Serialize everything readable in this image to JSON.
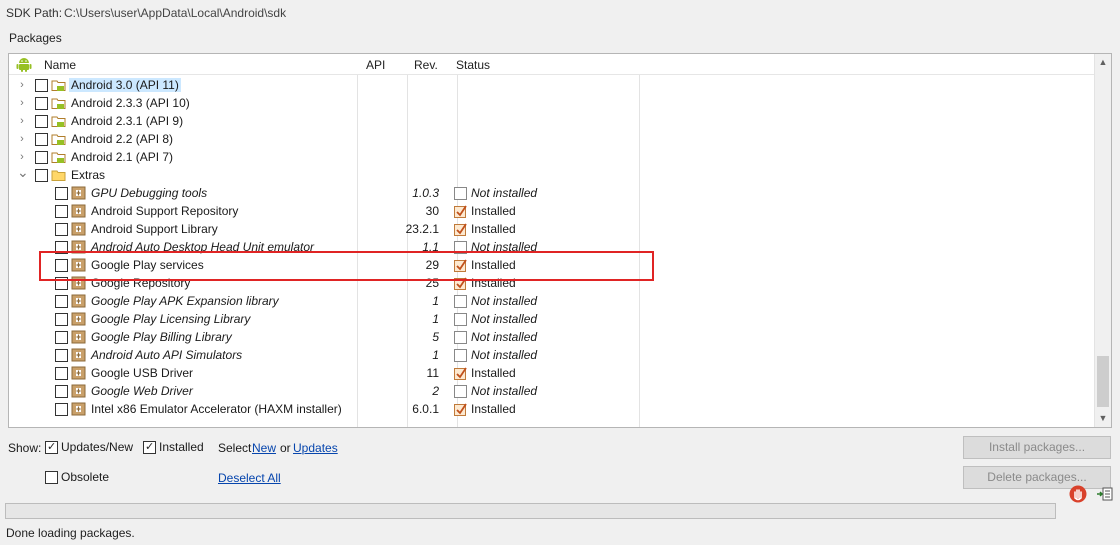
{
  "sdk": {
    "path_label": "SDK Path:",
    "path_value": "C:\\Users\\user\\AppData\\Local\\Android\\sdk"
  },
  "packages_label": "Packages",
  "table": {
    "headers": {
      "name": "Name",
      "api": "API",
      "rev": "Rev.",
      "status": "Status"
    },
    "rows": [
      {
        "name": "Android 3.0 (API 11)",
        "rev": "",
        "status": "",
        "installed": null,
        "italic": false,
        "level": 0,
        "expander": "collapsed",
        "icon": "android-folder-icon",
        "selected": true
      },
      {
        "name": "Android 2.3.3 (API 10)",
        "rev": "",
        "status": "",
        "installed": null,
        "italic": false,
        "level": 0,
        "expander": "collapsed",
        "icon": "android-folder-icon",
        "selected": false
      },
      {
        "name": "Android 2.3.1 (API 9)",
        "rev": "",
        "status": "",
        "installed": null,
        "italic": false,
        "level": 0,
        "expander": "collapsed",
        "icon": "android-folder-icon",
        "selected": false
      },
      {
        "name": "Android 2.2 (API 8)",
        "rev": "",
        "status": "",
        "installed": null,
        "italic": false,
        "level": 0,
        "expander": "collapsed",
        "icon": "android-folder-icon",
        "selected": false
      },
      {
        "name": "Android 2.1 (API 7)",
        "rev": "",
        "status": "",
        "installed": null,
        "italic": false,
        "level": 0,
        "expander": "collapsed",
        "icon": "android-folder-icon",
        "selected": false
      },
      {
        "name": "Extras",
        "rev": "",
        "status": "",
        "installed": null,
        "italic": false,
        "level": 0,
        "expander": "expanded",
        "icon": "folder-icon",
        "selected": false
      },
      {
        "name": "GPU Debugging tools",
        "rev": "1.0.3",
        "status": "Not installed",
        "installed": false,
        "italic": true,
        "level": 1,
        "expander": "none",
        "icon": "package-icon",
        "selected": false
      },
      {
        "name": "Android Support Repository",
        "rev": "30",
        "status": "Installed",
        "installed": true,
        "italic": false,
        "level": 1,
        "expander": "none",
        "icon": "package-icon",
        "selected": false
      },
      {
        "name": "Android Support Library",
        "rev": "23.2.1",
        "status": "Installed",
        "installed": true,
        "italic": false,
        "level": 1,
        "expander": "none",
        "icon": "package-icon",
        "selected": false
      },
      {
        "name": "Android Auto Desktop Head Unit emulator",
        "rev": "1.1",
        "status": "Not installed",
        "installed": false,
        "italic": true,
        "level": 1,
        "expander": "none",
        "icon": "package-icon",
        "selected": false
      },
      {
        "name": "Google Play services",
        "rev": "29",
        "status": "Installed",
        "installed": true,
        "italic": false,
        "level": 1,
        "expander": "none",
        "icon": "package-icon",
        "selected": false
      },
      {
        "name": "Google Repository",
        "rev": "25",
        "status": "Installed",
        "installed": true,
        "italic": false,
        "level": 1,
        "expander": "none",
        "icon": "package-icon",
        "selected": false
      },
      {
        "name": "Google Play APK Expansion library",
        "rev": "1",
        "status": "Not installed",
        "installed": false,
        "italic": true,
        "level": 1,
        "expander": "none",
        "icon": "package-icon",
        "selected": false
      },
      {
        "name": "Google Play Licensing Library",
        "rev": "1",
        "status": "Not installed",
        "installed": false,
        "italic": true,
        "level": 1,
        "expander": "none",
        "icon": "package-icon",
        "selected": false
      },
      {
        "name": "Google Play Billing Library",
        "rev": "5",
        "status": "Not installed",
        "installed": false,
        "italic": true,
        "level": 1,
        "expander": "none",
        "icon": "package-icon",
        "selected": false
      },
      {
        "name": "Android Auto API Simulators",
        "rev": "1",
        "status": "Not installed",
        "installed": false,
        "italic": true,
        "level": 1,
        "expander": "none",
        "icon": "package-icon",
        "selected": false
      },
      {
        "name": "Google USB Driver",
        "rev": "11",
        "status": "Installed",
        "installed": true,
        "italic": false,
        "level": 1,
        "expander": "none",
        "icon": "package-icon",
        "selected": false
      },
      {
        "name": "Google Web Driver",
        "rev": "2",
        "status": "Not installed",
        "installed": false,
        "italic": true,
        "level": 1,
        "expander": "none",
        "icon": "package-icon",
        "selected": false
      },
      {
        "name": "Intel x86 Emulator Accelerator (HAXM installer)",
        "rev": "6.0.1",
        "status": "Installed",
        "installed": true,
        "italic": false,
        "level": 1,
        "expander": "none",
        "icon": "package-icon",
        "selected": false
      }
    ],
    "highlighted_row": "Google Play services"
  },
  "show_bar": {
    "show_label": "Show:",
    "updates_new_label": "Updates/New",
    "updates_new_checked": true,
    "installed_label": "Installed",
    "installed_checked": true,
    "select_label": "Select",
    "new_link": "New",
    "or_label": "or",
    "updates_link": "Updates",
    "obsolete_label": "Obsolete",
    "obsolete_checked": false,
    "deselect_all_link": "Deselect All"
  },
  "buttons": {
    "install": "Install packages...",
    "delete": "Delete packages..."
  },
  "status_bar": {
    "message": "Done loading packages.",
    "progress": 0
  },
  "colors": {
    "highlight": "#e02424",
    "link": "#0645ad",
    "selection": "#cce8ff"
  }
}
